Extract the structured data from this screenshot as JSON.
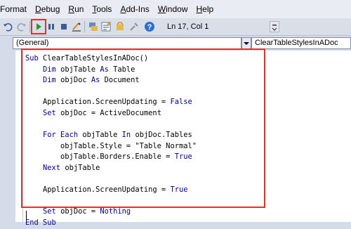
{
  "menu": {
    "items": [
      {
        "label": "Format"
      },
      {
        "label": "Debug",
        "underline": "D",
        "rest": "ebug"
      },
      {
        "label": "Run",
        "underline": "R",
        "rest": "un"
      },
      {
        "label": "Tools",
        "underline": "T",
        "rest": "ools"
      },
      {
        "label": "Add-Ins",
        "underline": "A",
        "rest": "dd-Ins"
      },
      {
        "label": "Window",
        "underline": "W",
        "rest": "indow"
      },
      {
        "label": "Help",
        "underline": "H",
        "rest": "elp"
      }
    ]
  },
  "toolbar": {
    "position_label": "Ln 17, Col 1",
    "icons": [
      "undo-icon",
      "redo-icon",
      "run-icon",
      "break-icon",
      "reset-icon",
      "design-mode-icon",
      "project-explorer-icon",
      "properties-icon",
      "object-browser-icon",
      "toolbox-icon",
      "help-icon"
    ]
  },
  "combos": {
    "object": "(General)",
    "procedure": "ClearTableStylesInADoc"
  },
  "code": {
    "lines": [
      [
        {
          "t": "Sub ",
          "k": true
        },
        {
          "t": "ClearTableStylesInADoc()"
        }
      ],
      [
        {
          "t": "    "
        },
        {
          "t": "Dim ",
          "k": true
        },
        {
          "t": "objTable "
        },
        {
          "t": "As ",
          "k": true
        },
        {
          "t": "Table"
        }
      ],
      [
        {
          "t": "    "
        },
        {
          "t": "Dim ",
          "k": true
        },
        {
          "t": "objDoc "
        },
        {
          "t": "As ",
          "k": true
        },
        {
          "t": "Document"
        }
      ],
      [
        {
          "t": ""
        }
      ],
      [
        {
          "t": "    Application.ScreenUpdating = "
        },
        {
          "t": "False",
          "k": true
        }
      ],
      [
        {
          "t": "    "
        },
        {
          "t": "Set ",
          "k": true
        },
        {
          "t": "objDoc = ActiveDocument"
        }
      ],
      [
        {
          "t": ""
        }
      ],
      [
        {
          "t": "    "
        },
        {
          "t": "For Each ",
          "k": true
        },
        {
          "t": "objTable "
        },
        {
          "t": "In ",
          "k": true
        },
        {
          "t": "objDoc.Tables"
        }
      ],
      [
        {
          "t": "        objTable.Style = \"Table Normal\""
        }
      ],
      [
        {
          "t": "        objTable.Borders.Enable = "
        },
        {
          "t": "True",
          "k": true
        }
      ],
      [
        {
          "t": "    "
        },
        {
          "t": "Next ",
          "k": true
        },
        {
          "t": "objTable"
        }
      ],
      [
        {
          "t": ""
        }
      ],
      [
        {
          "t": "    Application.ScreenUpdating = "
        },
        {
          "t": "True",
          "k": true
        }
      ],
      [
        {
          "t": ""
        }
      ],
      [
        {
          "t": "    "
        },
        {
          "t": "Set ",
          "k": true
        },
        {
          "t": "objDoc = "
        },
        {
          "t": "Nothing",
          "k": true
        }
      ],
      [
        {
          "t": "End Sub",
          "k": true
        }
      ]
    ]
  },
  "colors": {
    "keyword": "#00008b",
    "highlight": "#d9342b",
    "run_green": "#1f9e2c"
  }
}
